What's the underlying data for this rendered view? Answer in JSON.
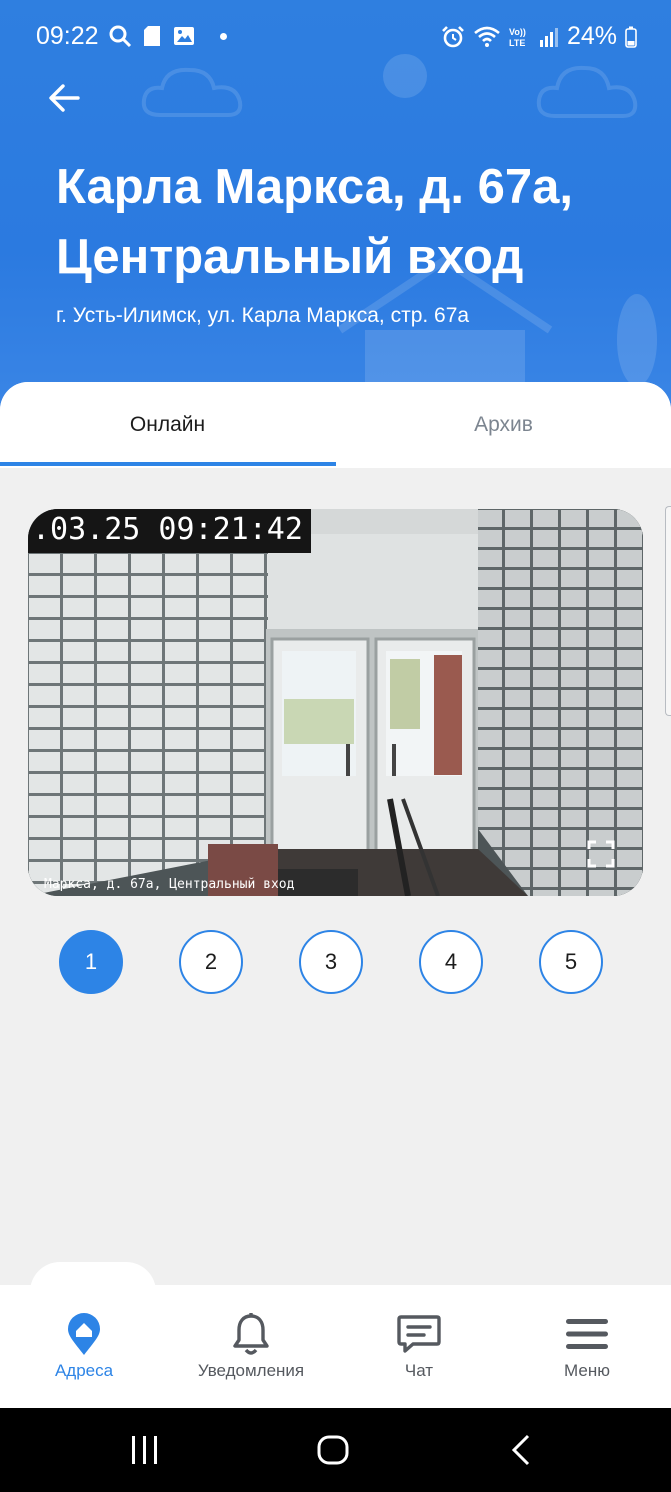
{
  "status_bar": {
    "time": "09:22",
    "battery": "24%",
    "left_icons": [
      "search-icon",
      "sd-card-icon",
      "gallery-icon",
      "dot-icon"
    ],
    "right_icons": [
      "alarm-icon",
      "wifi-icon",
      "volte-icon",
      "signal-icon",
      "battery-icon"
    ]
  },
  "header": {
    "title": "Карла Маркса, д. 67а, Центральный вход",
    "address": "г. Усть-Илимск, ул. Карла Маркса, стр. 67а"
  },
  "tabs": [
    {
      "label": "Онлайн",
      "selected": true
    },
    {
      "label": "Архив",
      "selected": false
    }
  ],
  "video": {
    "timestamp": ".03.25 09:21:42",
    "caption": "Маркса, д. 67а, Центральный вход"
  },
  "cameras": [
    {
      "label": "1",
      "selected": true
    },
    {
      "label": "2",
      "selected": false
    },
    {
      "label": "3",
      "selected": false
    },
    {
      "label": "4",
      "selected": false
    },
    {
      "label": "5",
      "selected": false
    }
  ],
  "bottom_nav": [
    {
      "label": "Адреса",
      "icon": "house-pin-icon",
      "active": true
    },
    {
      "label": "Уведомления",
      "icon": "bell-icon",
      "active": false
    },
    {
      "label": "Чат",
      "icon": "chat-icon",
      "active": false
    },
    {
      "label": "Меню",
      "icon": "menu-icon",
      "active": false
    }
  ],
  "colors": {
    "accent": "#2d84e6",
    "header": "#2b7ae0",
    "background": "#f0f0f0"
  }
}
